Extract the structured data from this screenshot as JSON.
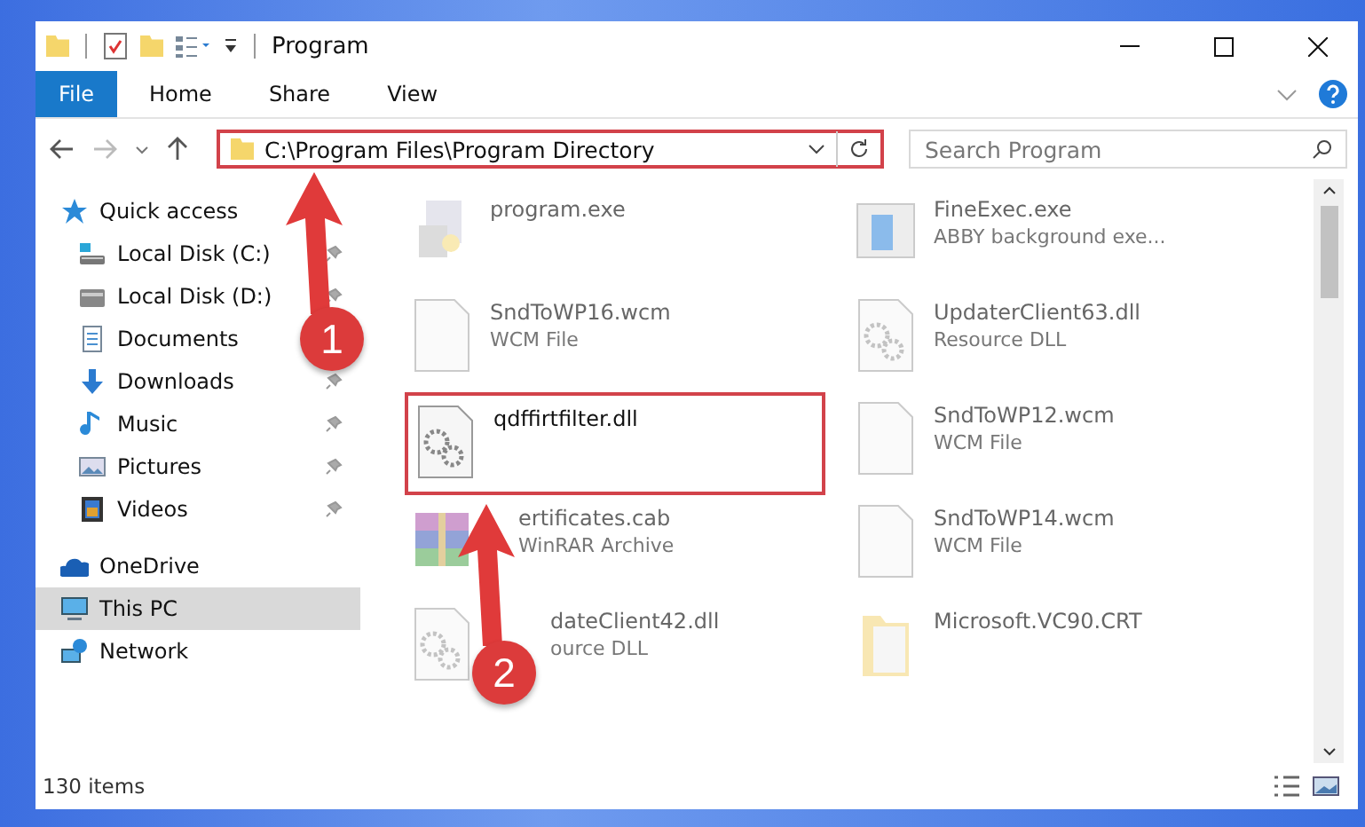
{
  "window": {
    "title": "Program"
  },
  "ribbon": {
    "tabs": [
      {
        "label": "File",
        "kind": "file"
      },
      {
        "label": "Home",
        "kind": "tab"
      },
      {
        "label": "Share",
        "kind": "tab"
      },
      {
        "label": "View",
        "kind": "tab"
      }
    ]
  },
  "address": {
    "path": "C:\\Program Files\\Program Directory",
    "highlighted": true
  },
  "search": {
    "placeholder": "Search Program"
  },
  "sidebar": {
    "items": [
      {
        "label": "Quick access",
        "kind": "star",
        "selected": false,
        "pinned": false,
        "children": [
          {
            "label": "Local Disk (C:)",
            "kind": "system-drive",
            "selected": false,
            "pinned": true
          },
          {
            "label": "Local Disk (D:)",
            "kind": "drive",
            "selected": false,
            "pinned": true
          },
          {
            "label": "Documents",
            "kind": "documents",
            "selected": false,
            "pinned": false
          },
          {
            "label": "Downloads",
            "kind": "downloads",
            "selected": false,
            "pinned": true
          },
          {
            "label": "Music",
            "kind": "music",
            "selected": false,
            "pinned": true
          },
          {
            "label": "Pictures",
            "kind": "pictures",
            "selected": false,
            "pinned": true
          },
          {
            "label": "Videos",
            "kind": "videos",
            "selected": false,
            "pinned": true
          }
        ]
      },
      {
        "label": "OneDrive",
        "kind": "cloud",
        "selected": false,
        "pinned": false
      },
      {
        "label": "This PC",
        "kind": "computer",
        "selected": true,
        "pinned": false
      },
      {
        "label": "Network",
        "kind": "network",
        "selected": false,
        "pinned": false
      }
    ]
  },
  "files": [
    {
      "name": "program.exe",
      "kind": "installer",
      "blurred": true,
      "highlighted": false
    },
    {
      "name": "FineExec.exe",
      "type": "ABBY background exe...",
      "kind": "application",
      "blurred": true,
      "highlighted": false
    },
    {
      "name": "SndToWP16.wcm",
      "type": "WCM File",
      "kind": "file",
      "blurred": true,
      "highlighted": false
    },
    {
      "name": "UpdaterClient63.dll",
      "type": "Resource DLL",
      "kind": "library",
      "blurred": true,
      "highlighted": false
    },
    {
      "name": "qdffirtfilter.dll",
      "kind": "library",
      "blurred": false,
      "highlighted": true
    },
    {
      "name": "SndToWP12.wcm",
      "type": "WCM File",
      "kind": "file",
      "blurred": true,
      "highlighted": false
    },
    {
      "name": "ertificates.cab",
      "type": "WinRAR Archive",
      "kind": "archive",
      "blurred": true,
      "highlighted": false
    },
    {
      "name": "SndToWP14.wcm",
      "type": "WCM File",
      "kind": "file",
      "blurred": true,
      "highlighted": false
    },
    {
      "name": "dateClient42.dll",
      "type": "ource DLL",
      "kind": "library",
      "blurred": true,
      "highlighted": false
    },
    {
      "name": "Microsoft.VC90.CRT",
      "kind": "folder",
      "blurred": true,
      "highlighted": false
    }
  ],
  "status_bar": {
    "text": "130 items"
  },
  "annotations": [
    {
      "number": "1"
    },
    {
      "number": "2"
    }
  ]
}
